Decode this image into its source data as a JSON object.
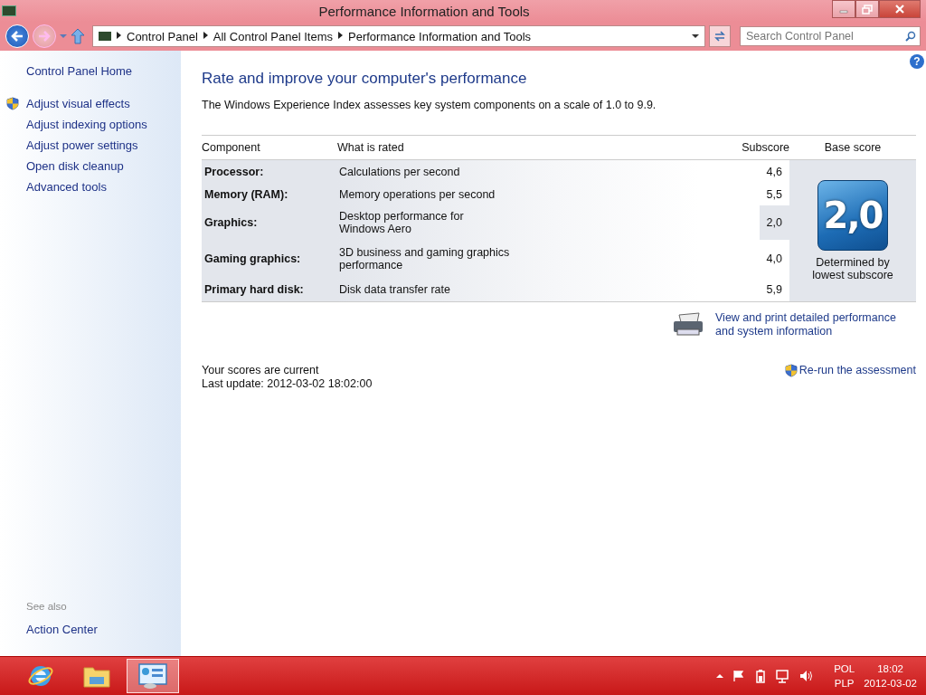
{
  "window": {
    "title": "Performance Information and Tools"
  },
  "address_bar": {
    "breadcrumbs": [
      "Control Panel",
      "All Control Panel Items",
      "Performance Information and Tools"
    ],
    "search": {
      "placeholder": "Search Control Panel"
    }
  },
  "sidebar": {
    "home": "Control Panel Home",
    "items": [
      {
        "label": "Adjust visual effects",
        "shield": true
      },
      {
        "label": "Adjust indexing options",
        "shield": false
      },
      {
        "label": "Adjust power settings",
        "shield": false
      },
      {
        "label": "Open disk cleanup",
        "shield": false
      },
      {
        "label": "Advanced tools",
        "shield": false
      }
    ],
    "see_also": {
      "heading": "See also",
      "links": [
        "Action Center"
      ]
    }
  },
  "main": {
    "help": "?",
    "heading": "Rate and improve your computer's performance",
    "intro": "The Windows Experience Index assesses key system components on a scale of 1.0 to 9.9.",
    "table": {
      "columns": [
        "Component",
        "What is rated",
        "Subscore",
        "Base score"
      ],
      "rows": [
        {
          "component": "Processor:",
          "rated": "Calculations per second",
          "subscore": "4,6",
          "lowest": false
        },
        {
          "component": "Memory (RAM):",
          "rated": "Memory operations per second",
          "subscore": "5,5",
          "lowest": false
        },
        {
          "component": "Graphics:",
          "rated": "Desktop performance for Windows Aero",
          "subscore": "2,0",
          "lowest": true
        },
        {
          "component": "Gaming graphics:",
          "rated": "3D business and gaming graphics performance",
          "subscore": "4,0",
          "lowest": false
        },
        {
          "component": "Primary hard disk:",
          "rated": "Disk data transfer rate",
          "subscore": "5,9",
          "lowest": false
        }
      ],
      "base_score": "2,0",
      "base_note": "Determined by lowest subscore"
    },
    "print_link": "View and print detailed performance and system information",
    "status": [
      "Your scores are current",
      "Last update: 2012-03-02 18:02:00"
    ],
    "rerun_link": "Re-run the assessment"
  },
  "taskbar": {
    "apps": [
      {
        "kind": "browser",
        "active": false
      },
      {
        "kind": "folder",
        "active": false
      },
      {
        "kind": "panel",
        "active": true
      }
    ],
    "language": [
      "POL",
      "PLP"
    ],
    "time": "18:02",
    "date": "2012-03-02"
  }
}
